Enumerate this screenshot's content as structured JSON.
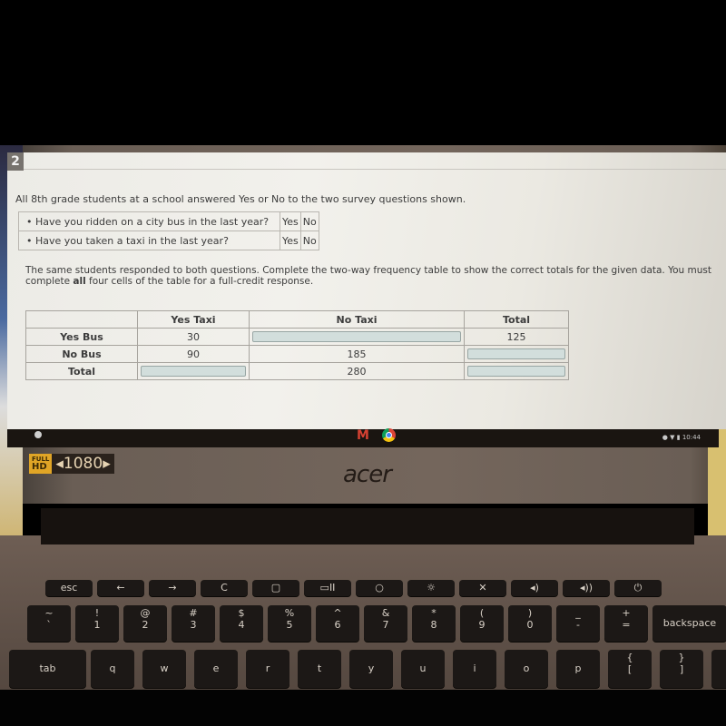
{
  "question": {
    "number": "2",
    "intro": "All 8th grade students at a school answered Yes or No to the two survey questions shown.",
    "survey": [
      {
        "bullet": "•",
        "text": "Have you ridden on a city bus in the last year?",
        "yes": "Yes",
        "no": "No"
      },
      {
        "bullet": "•",
        "text": "Have you taken a taxi in the last year?",
        "yes": "Yes",
        "no": "No"
      }
    ],
    "instructions_pre": "The same students responded to both questions. Complete the two-way frequency table to show the correct totals for the given data. You must complete ",
    "instructions_bold": "all",
    "instructions_post": " four cells of the table for a full-credit response."
  },
  "table": {
    "col_headers": [
      "",
      "Yes Taxi",
      "No Taxi",
      "Total"
    ],
    "rows": [
      {
        "label": "Yes Bus",
        "cells": [
          {
            "value": "30",
            "input": false
          },
          {
            "value": "",
            "input": true
          },
          {
            "value": "125",
            "input": false
          }
        ]
      },
      {
        "label": "No Bus",
        "cells": [
          {
            "value": "90",
            "input": false
          },
          {
            "value": "185",
            "input": false
          },
          {
            "value": "",
            "input": true
          }
        ]
      },
      {
        "label": "Total",
        "cells": [
          {
            "value": "",
            "input": true
          },
          {
            "value": "280",
            "input": false
          },
          {
            "value": "",
            "input": true
          }
        ]
      }
    ]
  },
  "shelf": {
    "apps": [
      "gmail-icon",
      "chrome-icon"
    ],
    "gmail_glyph": "M",
    "tray_text": "10:44",
    "tray_icons": [
      "notification-icon",
      "wifi-icon",
      "battery-icon"
    ]
  },
  "bezel": {
    "badge_top": "FULL",
    "badge_mid": "HD",
    "badge_res": "◂1080▸",
    "brand": "acer"
  },
  "keyboard": {
    "row0": [
      "esc",
      "←",
      "→",
      "C",
      "▢",
      "▭II",
      "○",
      "☼",
      "✕",
      "◂)",
      "◂))",
      "⏻"
    ],
    "row1": [
      [
        "~",
        "`"
      ],
      [
        "!",
        "1"
      ],
      [
        "@",
        "2"
      ],
      [
        "#",
        "3"
      ],
      [
        "$",
        "4"
      ],
      [
        "%",
        "5"
      ],
      [
        "^",
        "6"
      ],
      [
        "&",
        "7"
      ],
      [
        "*",
        "8"
      ],
      [
        "(",
        "9"
      ],
      [
        ")",
        "0"
      ],
      [
        "_",
        "-"
      ],
      [
        "+",
        "="
      ],
      [
        "",
        "backspace"
      ]
    ],
    "row2": [
      "tab",
      "q",
      "w",
      "e",
      "r",
      "t",
      "y",
      "u",
      "i",
      "o",
      "p",
      [
        "{",
        "["
      ],
      [
        "}",
        "]"
      ],
      [
        "|",
        "\\"
      ]
    ]
  },
  "colors": {
    "input_fill": "#d2dedc",
    "qnum_bg": "#77736e",
    "badge_gold": "#e0a526"
  }
}
